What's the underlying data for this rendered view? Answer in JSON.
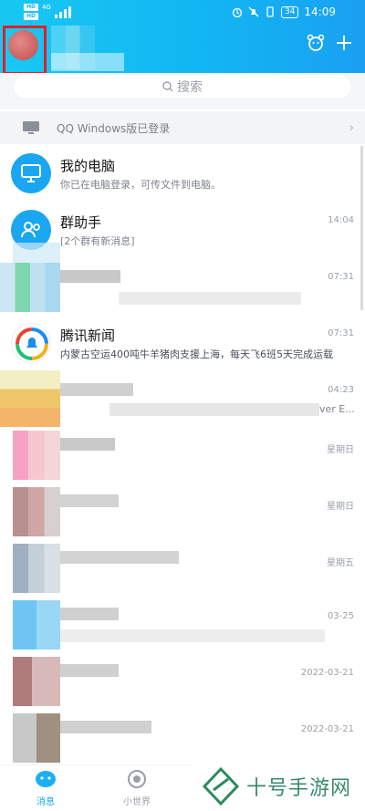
{
  "status_bar": {
    "time": "14:09",
    "battery": "34",
    "sim_labels": [
      "HD 1",
      "HD 2"
    ],
    "net_label": "4G"
  },
  "search": {
    "placeholder": "搜索"
  },
  "pc_login": {
    "text": "QQ Windows版已登录"
  },
  "conversations": [
    {
      "name": "我的电脑",
      "message": "你已在电脑登录，可传文件到电脑。",
      "time": ""
    },
    {
      "name": "群助手",
      "message": "[2个群有新消息]",
      "time": "14:04"
    },
    {
      "name": "",
      "message": "",
      "time": "07:31"
    },
    {
      "name": "腾讯新闻",
      "message": "内蒙古空运400吨牛羊猪肉支援上海，每天飞6班5天完成运载",
      "time": "07:31"
    },
    {
      "name": "",
      "message": "ver E...",
      "time": "04:23"
    },
    {
      "name": "",
      "message": "",
      "time": "星期日"
    },
    {
      "name": "",
      "message": "",
      "time": "星期日"
    },
    {
      "name": "",
      "message": "",
      "time": "星期五"
    },
    {
      "name": "",
      "message": "",
      "time": "03-25"
    },
    {
      "name": "",
      "message": "",
      "time": "2022-03-21"
    },
    {
      "name": "",
      "message": "",
      "time": "2022-03-21"
    }
  ],
  "bottom_nav": {
    "items": [
      {
        "label": "消息",
        "icon": "message-bubble-icon",
        "active": true
      },
      {
        "label": "小世界",
        "icon": "small-world-icon",
        "active": false
      }
    ]
  },
  "watermark": {
    "text": "十号手游网"
  },
  "colors": {
    "header": "#12b6f3",
    "accent": "#1bb0f2",
    "highlight_box": "#e0202a"
  }
}
